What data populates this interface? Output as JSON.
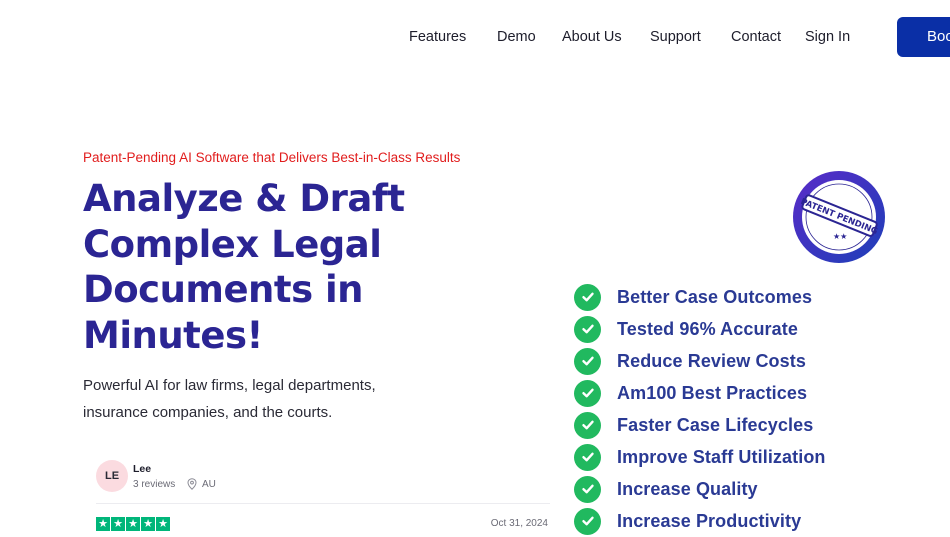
{
  "nav": {
    "items": [
      "Features",
      "Demo",
      "About Us",
      "Support",
      "Contact",
      "Sign In"
    ],
    "cta_label": "Boo"
  },
  "hero": {
    "eyebrow": "Patent-Pending AI Software that Delivers Best-in-Class Results",
    "headline": "Analyze & Draft Complex Legal Documents in Minutes!",
    "subhead": "Powerful AI for law firms, legal departments, insurance companies, and the courts."
  },
  "review": {
    "initials": "LE",
    "name": "Lee",
    "reviews": "3 reviews",
    "country": "AU",
    "rating": 5,
    "date": "Oct 31, 2024"
  },
  "badge": {
    "text": "PATENT PENDING"
  },
  "benefits": [
    "Better Case Outcomes",
    "Tested 96% Accurate",
    "Reduce Review Costs",
    "Am100 Best Practices",
    "Faster Case Lifecycles",
    "Improve Staff Utilization",
    "Increase Quality",
    "Increase Productivity"
  ],
  "colors": {
    "accent": "#0a2fa6",
    "headline": "#2b2593",
    "eyebrow": "#e11d1d",
    "check": "#21b95f",
    "trustpilot_star": "#00b67a"
  }
}
